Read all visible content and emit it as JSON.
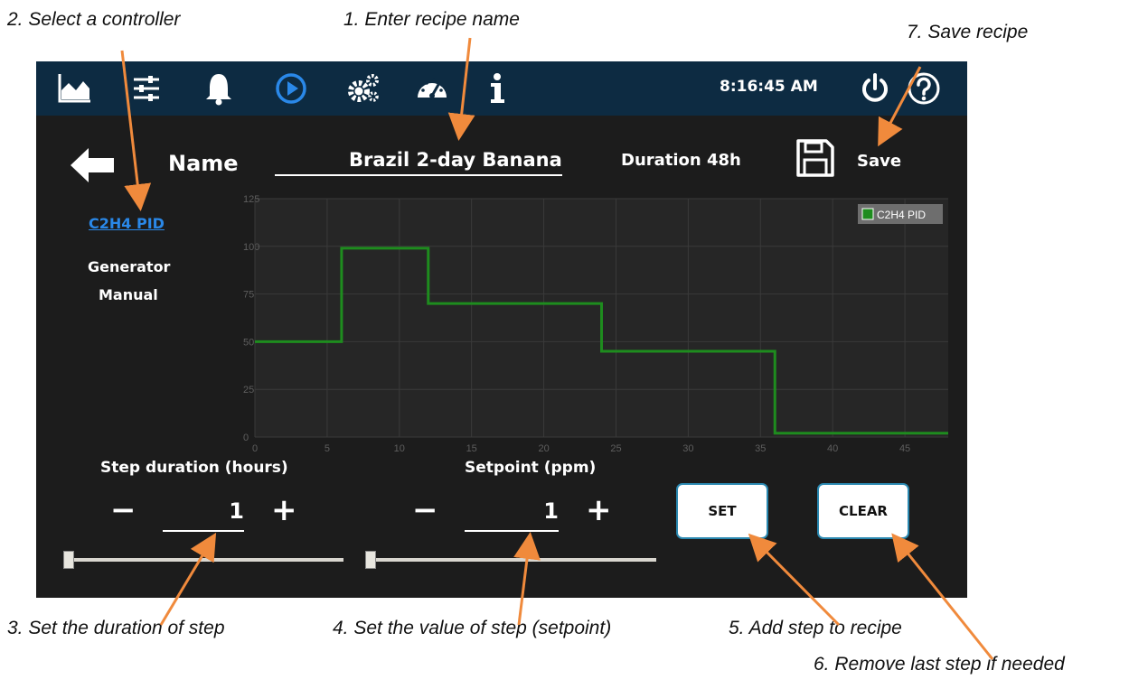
{
  "annotations": [
    "2. Select a controller",
    "1. Enter recipe name",
    "7. Save recipe",
    "3. Set the duration of step",
    "4. Set the value of step (setpoint)",
    "5. Add step to recipe",
    "6. Remove last step if needed"
  ],
  "topbar": {
    "time": "8:16:45 AM",
    "icons": [
      "chart-icon",
      "sliders-icon",
      "bell-icon",
      "play-icon",
      "gears-icon",
      "gauge-icon",
      "info-icon",
      "power-icon",
      "help-icon"
    ]
  },
  "editor": {
    "name_label": "Name",
    "recipe_name": "Brazil 2-day Banana",
    "duration": "Duration 48h",
    "save_label": "Save"
  },
  "controllers": {
    "selected": "C2H4 PID",
    "items": [
      "Generator",
      "Manual"
    ]
  },
  "step_duration": {
    "label": "Step duration (hours)",
    "value": "1",
    "slider_value": 1
  },
  "setpoint": {
    "label": "Setpoint (ppm)",
    "value": "1",
    "slider_value": 1
  },
  "buttons": {
    "set": "SET",
    "clear": "CLEAR"
  },
  "colors": {
    "topbar": "#0d2b42",
    "screen": "#1c1c1c",
    "accent_blue": "#2a88e8",
    "series": "#1e8c1e",
    "annotation_arrow": "#f08a3c"
  },
  "chart_data": {
    "type": "line",
    "step": true,
    "series": [
      {
        "name": "C2H4 PID",
        "color": "#1e8c1e",
        "x": [
          0,
          6,
          6,
          12,
          12,
          24,
          24,
          36,
          36,
          48
        ],
        "y": [
          50,
          50,
          99,
          99,
          70,
          70,
          45,
          45,
          2,
          2
        ]
      }
    ],
    "xlim": [
      0,
      48
    ],
    "ylim": [
      0,
      125
    ],
    "xticks": [
      0,
      5,
      10,
      15,
      20,
      25,
      30,
      35,
      40,
      45
    ],
    "yticks": [
      0,
      25,
      50,
      75,
      100,
      125
    ],
    "grid": true,
    "legend": "top-right"
  }
}
